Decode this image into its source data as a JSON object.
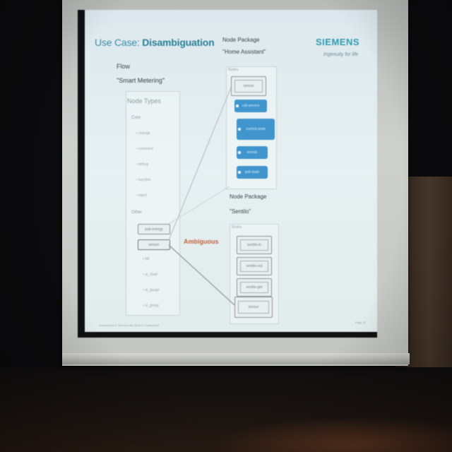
{
  "slide": {
    "title_prefix": "Use Case:",
    "title_main": "Disambiguation",
    "brand": "SIEMENS",
    "tagline": "Ingenuity for life",
    "flow_label": "Flow",
    "flow_name": "\"Smart Metering\"",
    "node_types_label": "Node Types",
    "core_label": "Core",
    "core_items": [
      "change",
      "comment",
      "debug",
      "function",
      "inject"
    ],
    "other_label": "Other",
    "other_items": [
      "pub-energy",
      "sensor",
      "bill",
      "ui_chart",
      "ui_gauge",
      "ui_group"
    ],
    "package1_label": "Node Package",
    "package1_name": "\"Home Assistant\"",
    "package1_section": "Nodes",
    "package1_nodes": [
      "sensor",
      "call-service",
      "current-state",
      "events",
      "poll-state"
    ],
    "package2_label": "Node Package",
    "package2_name": "\"Sentilo\"",
    "package2_section": "Nodes",
    "package2_nodes": [
      "sentilo-in",
      "sentilo-out",
      "sentilo-get",
      "sensor"
    ],
    "ambiguous_label": "Ambiguous",
    "footer_left": "Unrestricted © Siemens AG 2019      IT Conference",
    "page_number": "Page 12"
  },
  "colors": {
    "accent": "#3a8fa8",
    "ambiguous": "#c2623f",
    "node_blue": "#3f95cc"
  }
}
